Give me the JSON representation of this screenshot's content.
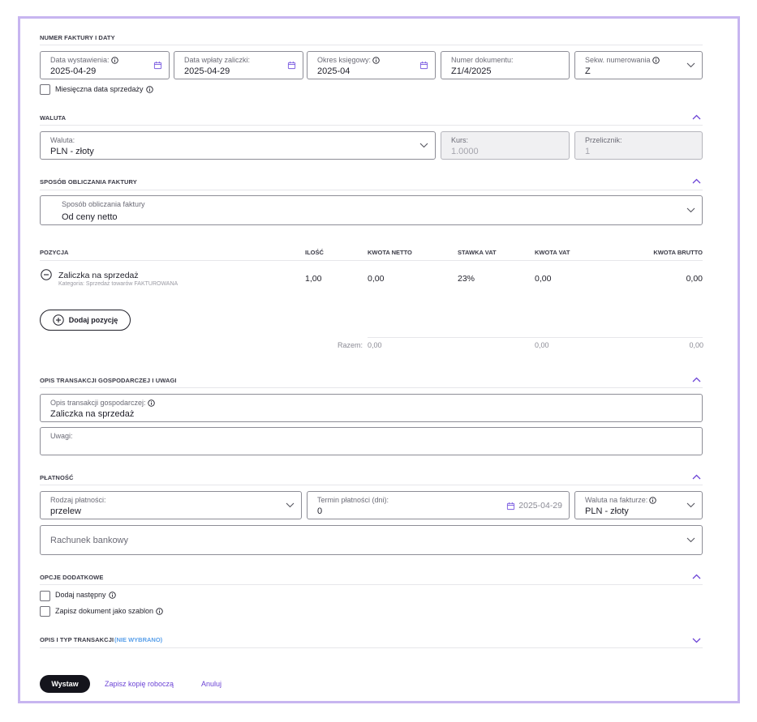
{
  "sections": {
    "numbering": {
      "title": "NUMER FAKTURY I DATY"
    },
    "currency": {
      "title": "WALUTA"
    },
    "calculation": {
      "title": "SPOSÓB OBLICZANIA FAKTURY"
    },
    "description": {
      "title": "OPIS TRANSAKCJI GOSPODARCZEJ I UWAGI"
    },
    "payment": {
      "title": "PŁATNOŚĆ"
    },
    "options": {
      "title": "OPCJE DODATKOWE"
    },
    "transaction_type": {
      "title": "OPIS I TYP TRANSAKCJI",
      "status": "(NIE WYBRANO)"
    }
  },
  "numbering": {
    "issue_date": {
      "label": "Data wystawienia:",
      "value": "2025-04-29"
    },
    "advance_date": {
      "label": "Data wpłaty zaliczki:",
      "value": "2025-04-29"
    },
    "period": {
      "label": "Okres księgowy:",
      "value": "2025-04"
    },
    "doc_number": {
      "label": "Numer dokumentu:",
      "value": "Z1/4/2025"
    },
    "sequence": {
      "label": "Sekw. numerowania",
      "value": "Z"
    },
    "monthly_sale_date": {
      "label": "Miesięczna data sprzedaży",
      "checked": false
    }
  },
  "currency": {
    "currency": {
      "label": "Waluta:",
      "value": "PLN - złoty"
    },
    "rate": {
      "label": "Kurs:",
      "value": "1.0000"
    },
    "converter": {
      "label": "Przelicznik:",
      "value": "1"
    }
  },
  "calculation": {
    "method": {
      "label": "Sposób obliczania faktury",
      "value": "Od ceny netto"
    }
  },
  "items": {
    "headers": {
      "position": "POZYCJA",
      "quantity": "ILOŚĆ",
      "net": "KWOTA NETTO",
      "vat_rate": "STAWKA VAT",
      "vat": "KWOTA VAT",
      "gross": "KWOTA BRUTTO"
    },
    "rows": [
      {
        "name": "Zaliczka na sprzedaż",
        "category": "Kategoria: Sprzedaż towarów FAKTUROWANA",
        "quantity": "1,00",
        "net": "0,00",
        "vat_rate": "23%",
        "vat": "0,00",
        "gross": "0,00"
      }
    ],
    "add_label": "Dodaj pozycję",
    "totals": {
      "label": "Razem:",
      "net": "0,00",
      "vat": "0,00",
      "gross": "0,00"
    }
  },
  "description": {
    "transaction": {
      "label": "Opis transakcji gospodarczej:",
      "value": "Zaliczka na sprzedaż"
    },
    "notes": {
      "label": "Uwagi:",
      "value": ""
    }
  },
  "payment": {
    "type": {
      "label": "Rodzaj płatności:",
      "value": "przelew"
    },
    "term": {
      "label": "Termin płatności (dni):",
      "value": "0",
      "date": "2025-04-29"
    },
    "invoice_currency": {
      "label": "Waluta na fakturze:",
      "value": "PLN - złoty"
    },
    "bank_account": {
      "placeholder": "Rachunek bankowy"
    }
  },
  "options": {
    "add_next": {
      "label": "Dodaj następny",
      "checked": false
    },
    "save_template": {
      "label": "Zapisz dokument jako szablon",
      "checked": false
    }
  },
  "actions": {
    "issue": "Wystaw",
    "save_draft": "Zapisz kopię roboczą",
    "cancel": "Anuluj"
  },
  "colors": {
    "frame": "#c7b5f0",
    "accent": "#6c44d6",
    "primary_button": "#14141c"
  }
}
